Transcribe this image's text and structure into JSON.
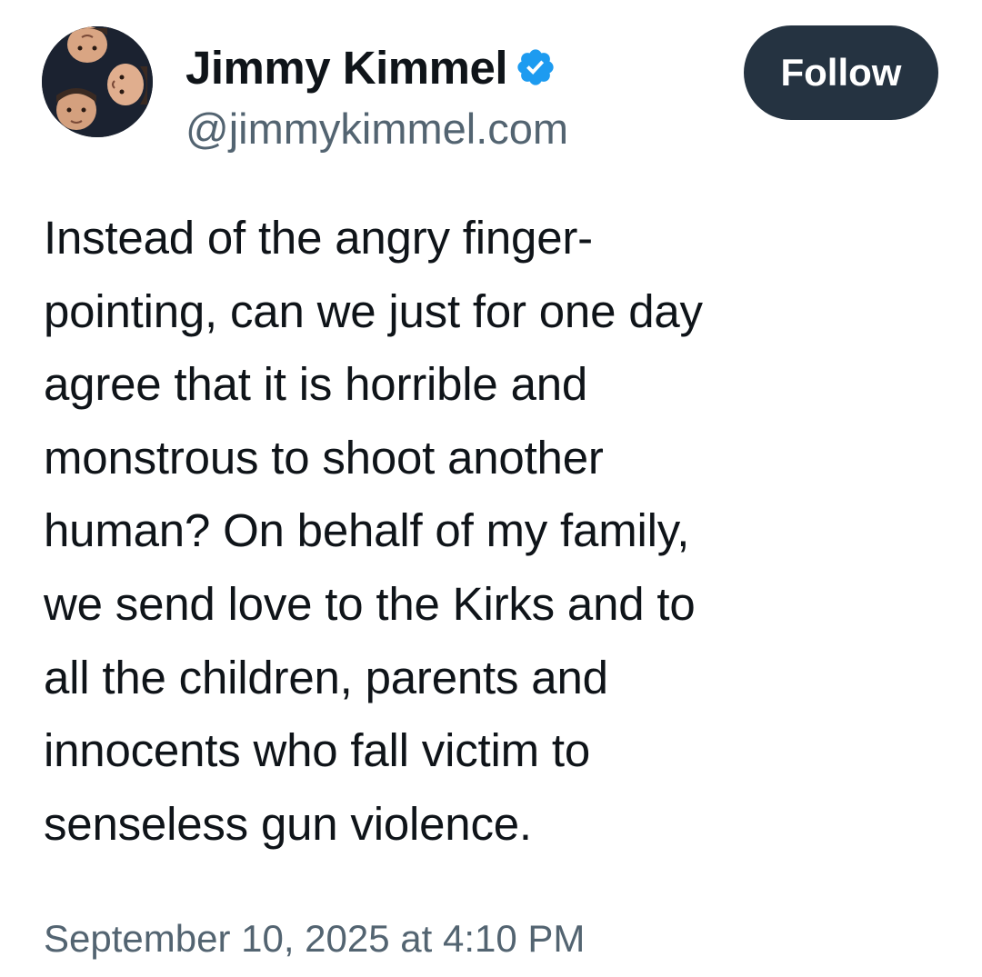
{
  "author": {
    "display_name": "Jimmy Kimmel",
    "handle": "@jimmykimmel.com",
    "verified": true,
    "avatar_icon": "avatar-photo"
  },
  "actions": {
    "follow_label": "Follow"
  },
  "post": {
    "text_lines": [
      "Instead of the angry finger-",
      "pointing, can we just for one day",
      "agree that it is horrible and",
      "monstrous to shoot another",
      "human? On behalf of my family,",
      "we send love to the Kirks and to",
      "all the children, parents and",
      "innocents who fall victim to",
      "senseless gun violence."
    ],
    "timestamp": "September 10, 2025 at 4:10 PM"
  },
  "colors": {
    "follow_button_bg": "#253341",
    "verified_badge": "#1d9bf0",
    "secondary_text": "#536471",
    "primary_text": "#0f1419"
  }
}
